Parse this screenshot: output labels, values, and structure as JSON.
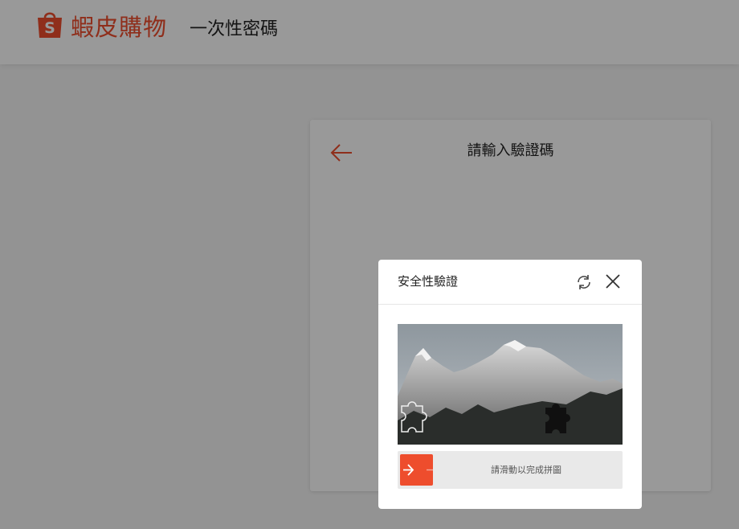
{
  "header": {
    "brand_name": "蝦皮購物",
    "brand_color": "#ee4d2d",
    "page_subtitle": "一次性密碼"
  },
  "otp_card": {
    "title": "請輸入驗證碼",
    "back_icon": "arrow-left-icon"
  },
  "captcha": {
    "title": "安全性驗證",
    "refresh_icon": "refresh-icon",
    "close_icon": "close-icon",
    "slider_hint": "請滑動以完成拼圖",
    "slider_progress": 0,
    "handle_color": "#ee4d2d"
  }
}
